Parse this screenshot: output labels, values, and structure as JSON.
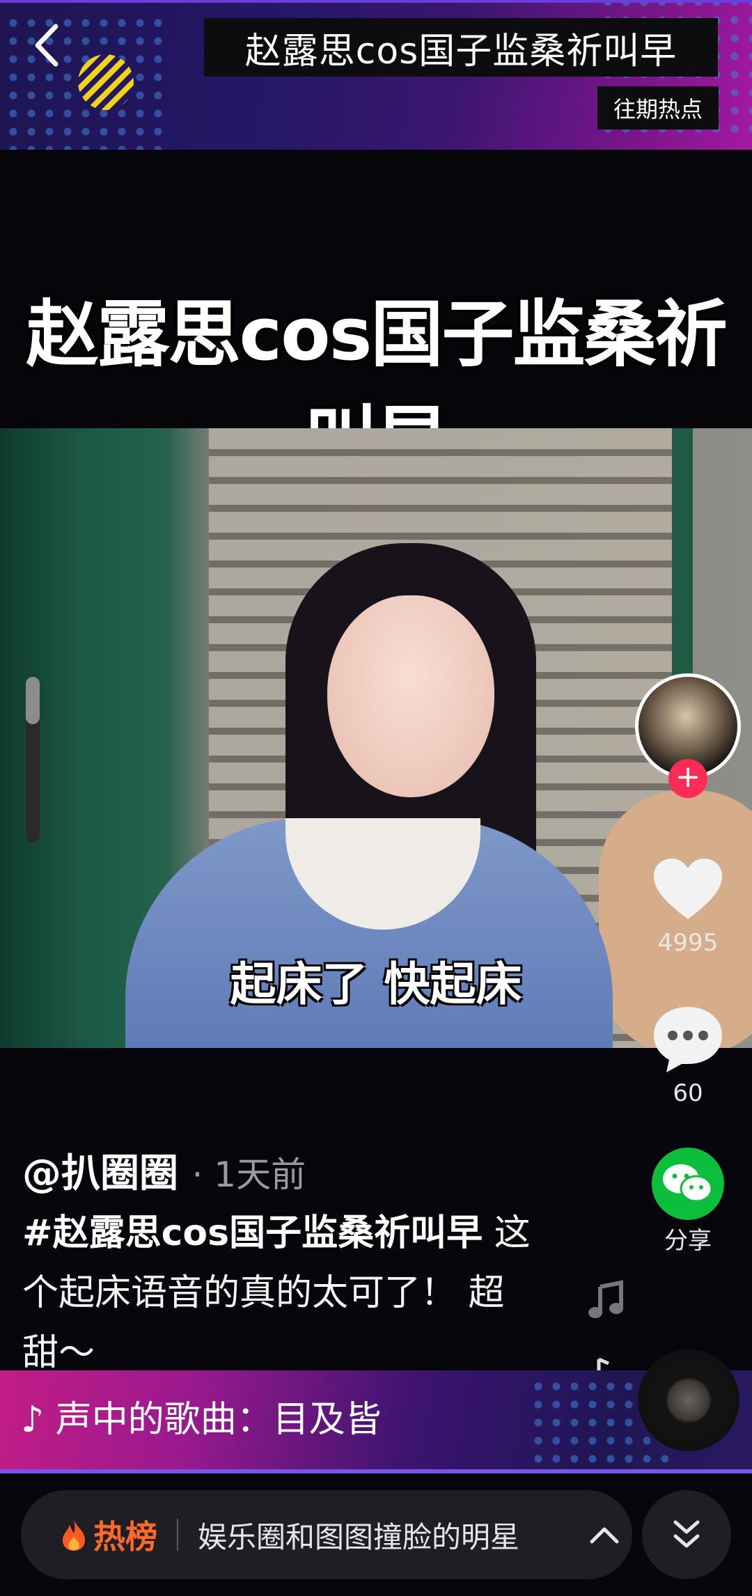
{
  "header": {
    "title": "赵露思cos国子监桑祈叫早",
    "past_hot": "往期热点"
  },
  "video": {
    "big_title": "赵露思cos国子监桑祈叫早",
    "subtitle": "起床了 快起床"
  },
  "side_actions": {
    "like_count": "4995",
    "comment_count": "60",
    "share_label": "分享"
  },
  "post": {
    "author": "@扒圈圈",
    "time": "· 1天前",
    "hashtag": "#赵露思cos国子监桑祈叫早",
    "text": " 这个起床语音的真的太可了！ 超甜～"
  },
  "music": {
    "label": "声中的歌曲：目及皆"
  },
  "bottom": {
    "hot_label": "热榜",
    "hot_text": "娱乐圈和图图撞脸的明星"
  },
  "colors": {
    "like_red": "#fe2c55",
    "wechat_green": "#0bbf3d",
    "hot_orange": "#ff6a2b"
  }
}
